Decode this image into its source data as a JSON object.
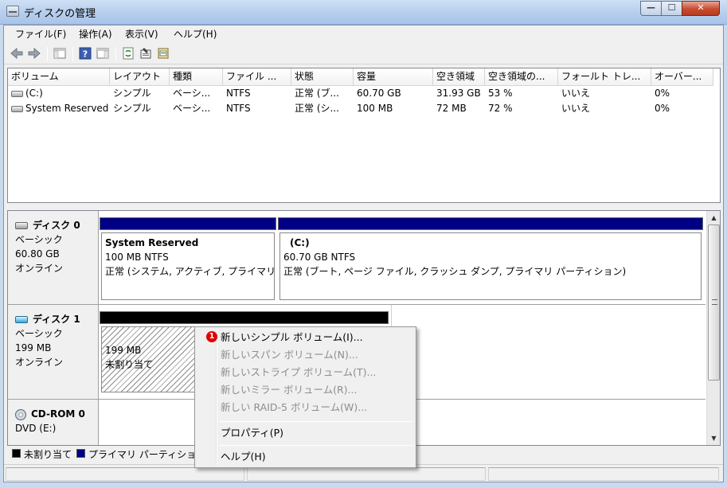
{
  "window": {
    "title": "ディスクの管理",
    "min_glyph": "—",
    "max_glyph": "☐",
    "close_glyph": "✕"
  },
  "menu": [
    "ファイル(F)",
    "操作(A)",
    "表示(V)",
    "ヘルプ(H)"
  ],
  "toolbar_icons": [
    "back-arrow-icon",
    "forward-arrow-icon",
    "console-tree-icon",
    "help-icon",
    "properties-pane-icon",
    "refresh-icon",
    "properties-icon",
    "disk-settings-icon"
  ],
  "volume_list": {
    "columns": [
      "ボリューム",
      "レイアウト",
      "種類",
      "ファイル ...",
      "状態",
      "容量",
      "空き領域",
      "空き領域の...",
      "フォールト トレ...",
      "オーバー..."
    ],
    "rows": [
      [
        "(C:)",
        "シンプル",
        "ベーシ...",
        "NTFS",
        "正常 (ブ...",
        "60.70 GB",
        "31.93 GB",
        "53 %",
        "いいえ",
        "0%"
      ],
      [
        "System Reserved",
        "シンプル",
        "ベーシ...",
        "NTFS",
        "正常 (シ...",
        "100 MB",
        "72 MB",
        "72 %",
        "いいえ",
        "0%"
      ]
    ]
  },
  "disks": {
    "disk0": {
      "name": "ディスク 0",
      "type": "ベーシック",
      "size": "60.80 GB",
      "status": "オンライン",
      "partitions": [
        {
          "name": "System Reserved",
          "size": "100 MB NTFS",
          "status": "正常 (システム, アクティブ, プライマリ"
        },
        {
          "name": "(C:)",
          "size": "60.70 GB NTFS",
          "status": "正常 (ブート, ページ ファイル, クラッシュ ダンプ, プライマリ パーティション)"
        }
      ]
    },
    "disk1": {
      "name": "ディスク 1",
      "type": "ベーシック",
      "size": "199 MB",
      "status": "オンライン",
      "unallocated": {
        "size": "199 MB",
        "label": "未割り当て"
      }
    },
    "cdrom": {
      "name": "CD-ROM 0",
      "drive": "DVD (E:)"
    }
  },
  "legend": {
    "unallocated": "未割り当て",
    "primary": "プライマリ パーティション"
  },
  "context_menu": {
    "badge": "1",
    "items": {
      "new_simple": "新しいシンプル ボリューム(I)...",
      "new_spanned": "新しいスパン ボリューム(N)...",
      "new_striped": "新しいストライプ ボリューム(T)...",
      "new_mirror": "新しいミラー ボリューム(R)...",
      "new_raid5": "新しい RAID-5 ボリューム(W)...",
      "properties": "プロパティ(P)",
      "help": "ヘルプ(H)"
    }
  },
  "colors": {
    "primary_partition": "#000084",
    "unallocated": "#000000",
    "badge": "#e00000"
  }
}
